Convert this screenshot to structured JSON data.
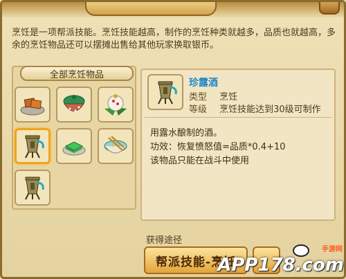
{
  "window": {
    "description": "烹饪是一项帮派技能。烹饪技能越高，制作的烹饪种类就越多，品质也就越高，多余的烹饪物品还可以摆摊出售给其他玩家换取银币。"
  },
  "category": {
    "label": "全部烹饪物品"
  },
  "items": [
    {
      "icon": "tofu-dish-icon"
    },
    {
      "icon": "green-bowl-icon"
    },
    {
      "icon": "rice-ball-icon"
    },
    {
      "icon": "bronze-wine-vessel-icon"
    },
    {
      "icon": "green-cake-icon"
    },
    {
      "icon": "soup-bowl-icon"
    },
    {
      "icon": "bronze-wine-vessel-icon"
    }
  ],
  "selected_index": 3,
  "detail": {
    "name": "珍露酒",
    "type_key": "类型",
    "type_value": "烹饪",
    "level_key": "等级",
    "level_value": "烹饪技能达到30级可制作",
    "effect_lines": [
      "用露水酿制的酒。",
      "功效：恢复愤怒值=品质*0.4+10",
      "该物品只能在战斗中使用"
    ]
  },
  "obtain": {
    "label": "获得途径",
    "button_label": "帮派技能-烹饪"
  },
  "watermark": {
    "main": "APP178.com",
    "sub": "手游网"
  }
}
